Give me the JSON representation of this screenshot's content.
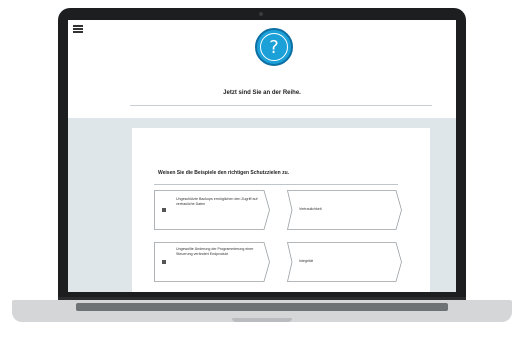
{
  "page": {
    "title": "Jetzt sind Sie an der Reihe.",
    "question_symbol": "?"
  },
  "card": {
    "heading": "Weisen Sie die Beispiele den richtigen Schutzzielen zu.",
    "pairs": [
      {
        "source": "Ungeschützte Backups ermöglichen den Zugriff auf vertrauliche Daten",
        "target": "Vertraulichkeit"
      },
      {
        "source": "Ungewollte Änderung der Programmierung einer Steuerung verändert Endprodukt",
        "target": "Integrität"
      }
    ]
  },
  "colors": {
    "accent": "#1ba0d8",
    "screen_background": "#dfe6e9"
  },
  "icons": {
    "menu": "hamburger-icon",
    "question": "question-mark-icon",
    "drag": "drag-handle-icon"
  }
}
